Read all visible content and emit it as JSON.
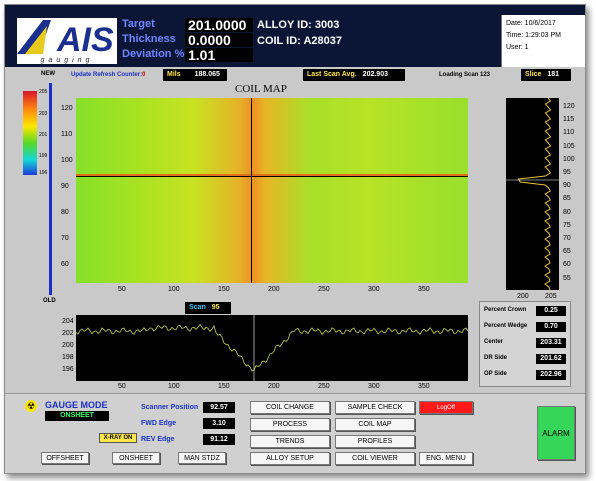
{
  "header": {
    "target_label": "Target",
    "target_value": "201.0000",
    "thickness_label": "Thickness",
    "thickness_value": "0.0000",
    "deviation_label": "Deviation %",
    "deviation_value": "1.01",
    "alloy": "ALLOY ID: 3003",
    "coil": "COIL ID: A28037",
    "logo": "AIS",
    "logo_sub": "gauging",
    "date": "Date: 10/6/2017",
    "time": "Time: 1:29:03 PM",
    "user": "User: 1"
  },
  "status": {
    "new": "NEW",
    "old": "OLD",
    "refresh": "Update Refresh Counter:",
    "refresh_count": "0",
    "mils_label": "Mils",
    "mils_value": "188.065",
    "last_scan_label": "Last Scan Avg.",
    "last_scan_value": "202.903",
    "loading": "Loading Scan 123",
    "slice_label": "Slice",
    "slice_value": "181",
    "scan_label": "Scan",
    "scan_value": "95"
  },
  "coilmap": {
    "title": "COIL MAP",
    "x_ticks": [
      "50",
      "100",
      "150",
      "200",
      "250",
      "300",
      "350"
    ],
    "y_ticks": [
      "120",
      "110",
      "100",
      "90",
      "80",
      "70",
      "60"
    ],
    "legend": [
      "205",
      "203",
      "201",
      "199",
      "196"
    ]
  },
  "slice_plot": {
    "y_ticks": [
      "120",
      "115",
      "110",
      "105",
      "100",
      "95",
      "90",
      "85",
      "80",
      "75",
      "70",
      "65",
      "60",
      "55"
    ],
    "x_ticks": [
      "200",
      "205"
    ]
  },
  "scan_plot": {
    "y_ticks": [
      "204",
      "202",
      "200",
      "198",
      "196"
    ],
    "x_ticks": [
      "50",
      "100",
      "150",
      "200",
      "250",
      "300",
      "350"
    ]
  },
  "stats": [
    {
      "label": "Percent Crown",
      "value": "0.25"
    },
    {
      "label": "Percent Wedge",
      "value": "0.70"
    },
    {
      "label": "Center",
      "value": "203.31"
    },
    {
      "label": "DR Side",
      "value": "201.62"
    },
    {
      "label": "OP Side",
      "value": "202.96"
    }
  ],
  "gauge": {
    "title": "GAUGE MODE",
    "mode": "ONSHEET",
    "xray": "X-RAY ON"
  },
  "scanner": {
    "pos_label": "Scanner Position",
    "pos_value": "92.57",
    "fwd_label": "FWD Edge",
    "fwd_value": "3.10",
    "rev_label": "REV Edge",
    "rev_value": "91.12"
  },
  "buttons": {
    "offsheet": "OFFSHEET",
    "onsheet": "ONSHEET",
    "manstdz": "MAN STDZ",
    "coil_change": "COIL CHANGE",
    "sample_check": "SAMPLE CHECK",
    "logoff": "LogOff",
    "process": "PROCESS",
    "coil_map": "COIL MAP",
    "trends": "TRENDS",
    "profiles": "PROFILES",
    "alloy_setup": "ALLOY SETUP",
    "coil_viewer": "COIL VIEWER",
    "eng_menu": "ENG. MENU",
    "alarm": "ALARM"
  },
  "colors": {
    "header_bg": "#0b1636",
    "label_blue": "#6f84ff",
    "tag_yellow": "#ffe74a",
    "alarm_green": "#35d65a",
    "logoff_red": "#ff1a1a"
  }
}
